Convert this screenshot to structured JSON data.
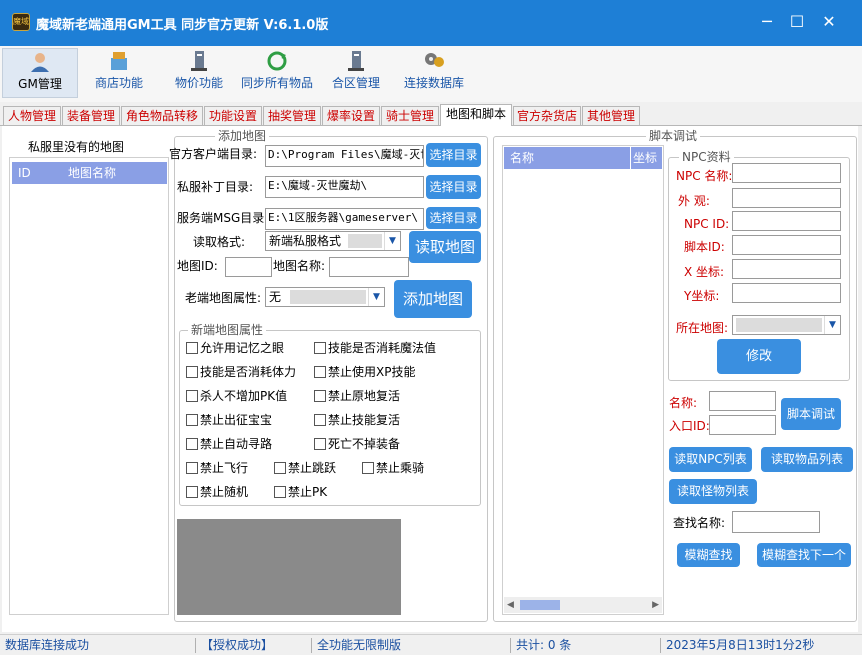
{
  "window": {
    "title": "魔域新老端通用GM工具 同步官方更新 V:6.1.0版",
    "app_icon_text": "魔域",
    "minimize": "─",
    "maximize": "☐",
    "close": "✕"
  },
  "toolbar": {
    "items": [
      {
        "label": "GM管理",
        "icon": "user-icon"
      },
      {
        "label": "商店功能",
        "icon": "shop-icon"
      },
      {
        "label": "物价功能",
        "icon": "computer-icon"
      },
      {
        "label": "同步所有物品",
        "icon": "sync-icon"
      },
      {
        "label": "合区管理",
        "icon": "server-icon"
      },
      {
        "label": "连接数据库",
        "icon": "database-icon"
      }
    ]
  },
  "tabs": [
    "人物管理",
    "装备管理",
    "角色物品转移",
    "功能设置",
    "抽奖管理",
    "爆率设置",
    "骑士管理",
    "地图和脚本",
    "官方杂货店",
    "其他管理"
  ],
  "left_list": {
    "title": "私服里没有的地图",
    "col_id": "ID",
    "col_name": "地图名称"
  },
  "add_map": {
    "group_title": "添加地图",
    "client_dir_label": "官方客户端目录:",
    "client_dir_value": "D:\\Program Files\\魔域-灭世",
    "patch_dir_label": "私服补丁目录:",
    "patch_dir_value": "E:\\魔域-灭世魔劫\\",
    "msg_dir_label": "服务端MSG目录:",
    "msg_dir_value": "E:\\1区服务器\\gameserver\\",
    "choose_dir": "选择目录",
    "read_format_label": "读取格式:",
    "read_format_value": "新端私服格式",
    "read_map_btn": "读取地图",
    "map_id_label": "地图ID:",
    "map_id_value": "",
    "map_name_label": "地图名称:",
    "map_name_value": "",
    "old_attr_label": "老端地图属性:",
    "old_attr_value": "无",
    "add_map_btn": "添加地图"
  },
  "new_attr": {
    "group_title": "新端地图属性",
    "options": [
      "允许用记忆之眼",
      "技能是否消耗魔法值",
      "技能是否消耗体力",
      "禁止使用XP技能",
      "杀人不增加PK值",
      "禁止原地复活",
      "禁止出征宝宝",
      "禁止技能复活",
      "禁止自动寻路",
      "死亡不掉装备",
      "禁止飞行",
      "禁止跳跃",
      "禁止乘骑",
      "禁止随机",
      "禁止PK"
    ]
  },
  "script": {
    "group_title": "脚本调试",
    "list_col_name": "名称",
    "list_col_coord": "坐标Y",
    "npc_group_title": "NPC资料",
    "npc_name_label": "NPC 名称:",
    "appearance_label": "外    观:",
    "npc_id_label": "NPC ID:",
    "script_id_label": "脚本ID:",
    "x_label": "X 坐标:",
    "y_label": "Y坐标:",
    "map_label": "所在地图:",
    "modify_btn": "修改",
    "name_label": "名称:",
    "entry_id_label": "入口ID:",
    "debug_btn": "脚本调试",
    "read_npc_btn": "读取NPC列表",
    "read_item_btn": "读取物品列表",
    "read_monster_btn": "读取怪物列表",
    "search_label": "查找名称:",
    "fuzzy_btn": "模糊查找",
    "fuzzy_next_btn": "模糊查找下一个"
  },
  "status": {
    "db": "数据库连接成功",
    "auth": "【授权成功】",
    "edition": "全功能无限制版",
    "total": "共计: 0 条",
    "datetime": "2023年5月8日13时1分2秒"
  },
  "colors": {
    "titlebar": "#1e7fd6",
    "button": "#3a8fe0",
    "tab_text": "#cc0000",
    "list_header": "#8a9fe5"
  }
}
